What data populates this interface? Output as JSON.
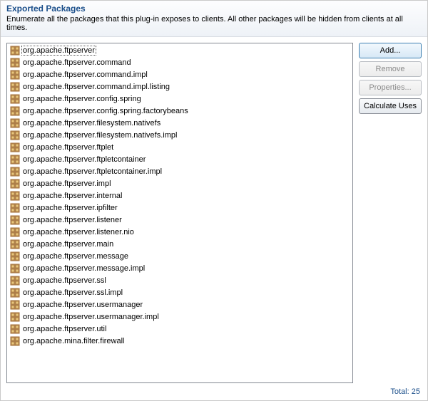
{
  "header": {
    "title": "Exported Packages",
    "description": "Enumerate all the packages that this plug-in exposes to clients.  All other packages will be hidden from clients at all times."
  },
  "packages": [
    "org.apache.ftpserver",
    "org.apache.ftpserver.command",
    "org.apache.ftpserver.command.impl",
    "org.apache.ftpserver.command.impl.listing",
    "org.apache.ftpserver.config.spring",
    "org.apache.ftpserver.config.spring.factorybeans",
    "org.apache.ftpserver.filesystem.nativefs",
    "org.apache.ftpserver.filesystem.nativefs.impl",
    "org.apache.ftpserver.ftplet",
    "org.apache.ftpserver.ftpletcontainer",
    "org.apache.ftpserver.ftpletcontainer.impl",
    "org.apache.ftpserver.impl",
    "org.apache.ftpserver.internal",
    "org.apache.ftpserver.ipfilter",
    "org.apache.ftpserver.listener",
    "org.apache.ftpserver.listener.nio",
    "org.apache.ftpserver.main",
    "org.apache.ftpserver.message",
    "org.apache.ftpserver.message.impl",
    "org.apache.ftpserver.ssl",
    "org.apache.ftpserver.ssl.impl",
    "org.apache.ftpserver.usermanager",
    "org.apache.ftpserver.usermanager.impl",
    "org.apache.ftpserver.util",
    "org.apache.mina.filter.firewall"
  ],
  "selected_index": 0,
  "buttons": {
    "add": "Add...",
    "remove": "Remove",
    "properties": "Properties...",
    "calculate": "Calculate Uses"
  },
  "footer": {
    "total_label": "Total:",
    "total_value": "25"
  }
}
